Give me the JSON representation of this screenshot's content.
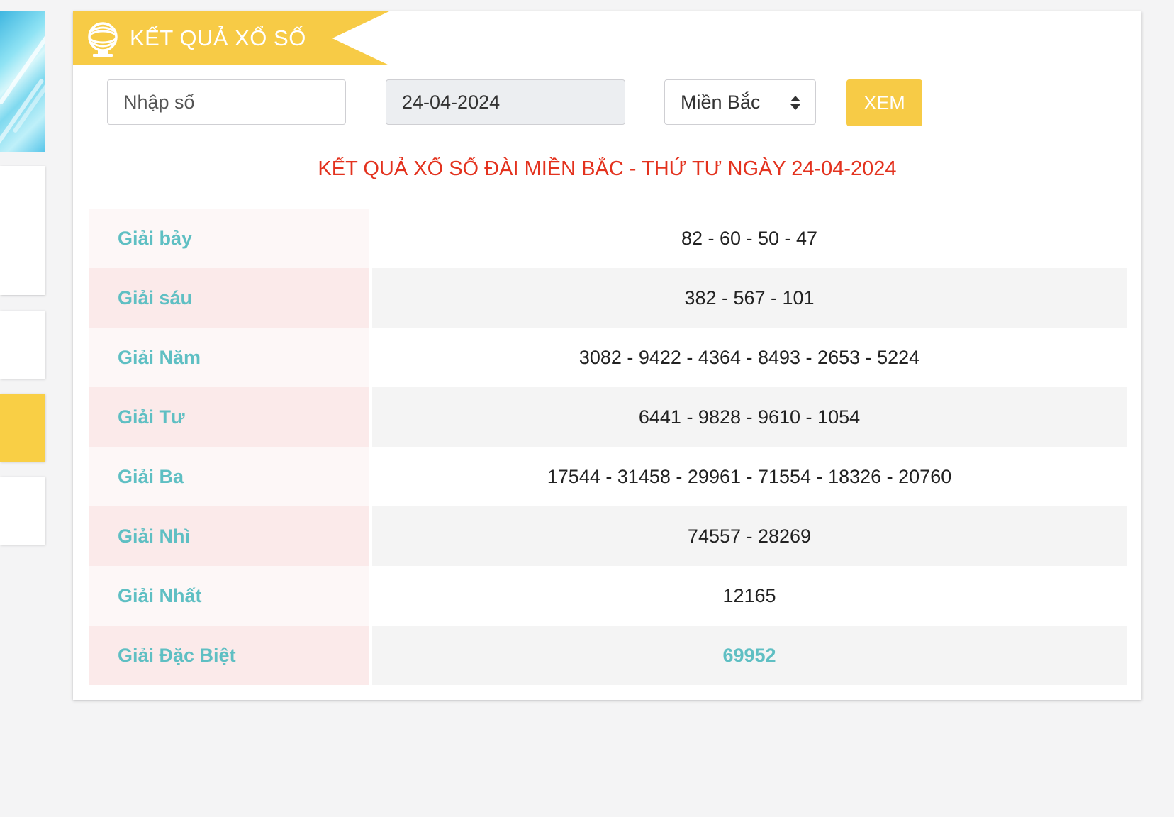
{
  "colors": {
    "accent": "#f7cb46",
    "heading_red": "#e3321e",
    "label_teal": "#5fbfc3"
  },
  "header": {
    "icon": "lottery-globe-icon",
    "title": "KẾT QUẢ XỔ SỐ"
  },
  "filters": {
    "number_placeholder": "Nhập số",
    "number_value": "",
    "date_value": "24-04-2024",
    "region_selected": "Miền Bắc",
    "submit_label": "XEM"
  },
  "result_heading": "KẾT QUẢ XỔ SỐ ĐÀI MIỀN BẮC - THỨ TƯ NGÀY 24-04-2024",
  "prizes": [
    {
      "label": "Giải bảy",
      "numbers": "82 - 60 - 50 - 47"
    },
    {
      "label": "Giải sáu",
      "numbers": "382 - 567 - 101"
    },
    {
      "label": "Giải Năm",
      "numbers": "3082 - 9422 - 4364 - 8493 - 2653 - 5224"
    },
    {
      "label": "Giải Tư",
      "numbers": "6441 - 9828 - 9610 - 1054"
    },
    {
      "label": "Giải Ba",
      "numbers": "17544 - 31458 - 29961 - 71554 - 18326 - 20760"
    },
    {
      "label": "Giải Nhì",
      "numbers": "74557 - 28269"
    },
    {
      "label": "Giải Nhất",
      "numbers": "12165"
    },
    {
      "label": "Giải Đặc Biệt",
      "numbers": "69952"
    }
  ]
}
